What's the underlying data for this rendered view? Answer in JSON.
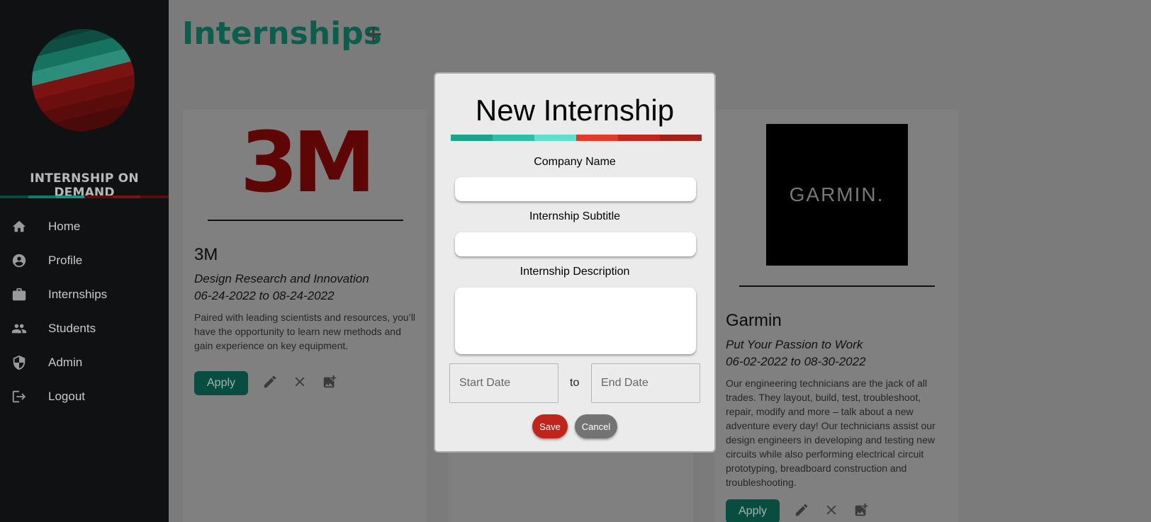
{
  "brand": {
    "name": "INTERNSHIP ON DEMAND",
    "colors": [
      "#1aa58a",
      "#5fd8c4",
      "#c8241f",
      "#8e1512"
    ]
  },
  "sidebar": {
    "items": [
      {
        "label": "Home",
        "icon": "home-icon"
      },
      {
        "label": "Profile",
        "icon": "account-circle-icon"
      },
      {
        "label": "Internships",
        "icon": "briefcase-icon"
      },
      {
        "label": "Students",
        "icon": "people-icon"
      },
      {
        "label": "Admin",
        "icon": "shield-icon"
      },
      {
        "label": "Logout",
        "icon": "logout-icon"
      }
    ]
  },
  "header": {
    "title": "Internships",
    "add_label": "+"
  },
  "cards": [
    {
      "logo_text": "3M",
      "company": "3M",
      "subtitle": "Design Research and Innovation",
      "dates": "06-24-2022 to 08-24-2022",
      "description": "Paired with leading scientists and resources, you’ll have the opportunity to learn new methods and gain experience on key equipment.",
      "apply_label": "Apply"
    },
    {
      "logo_text": "GARMIN.",
      "company": "Garmin",
      "subtitle": "Put Your Passion to Work",
      "dates": "06-02-2022 to 08-30-2022",
      "description": "Our engineering technicians are the jack of all trades. They layout, build, test, troubleshoot, repair, modify and more – talk about a new adventure every day! Our technicians assist our design engineers in developing and testing new circuits while also performing electrical circuit prototyping, breadboard construction and troubleshooting.",
      "apply_label": "Apply"
    }
  ],
  "modal": {
    "title": "New Internship",
    "company_label": "Company Name",
    "company_value": "",
    "subtitle_label": "Internship Subtitle",
    "subtitle_value": "",
    "description_label": "Internship Description",
    "description_value": "",
    "start_placeholder": "Start Date",
    "to_label": "to",
    "end_placeholder": "End Date",
    "save_label": "Save",
    "cancel_label": "Cancel"
  }
}
